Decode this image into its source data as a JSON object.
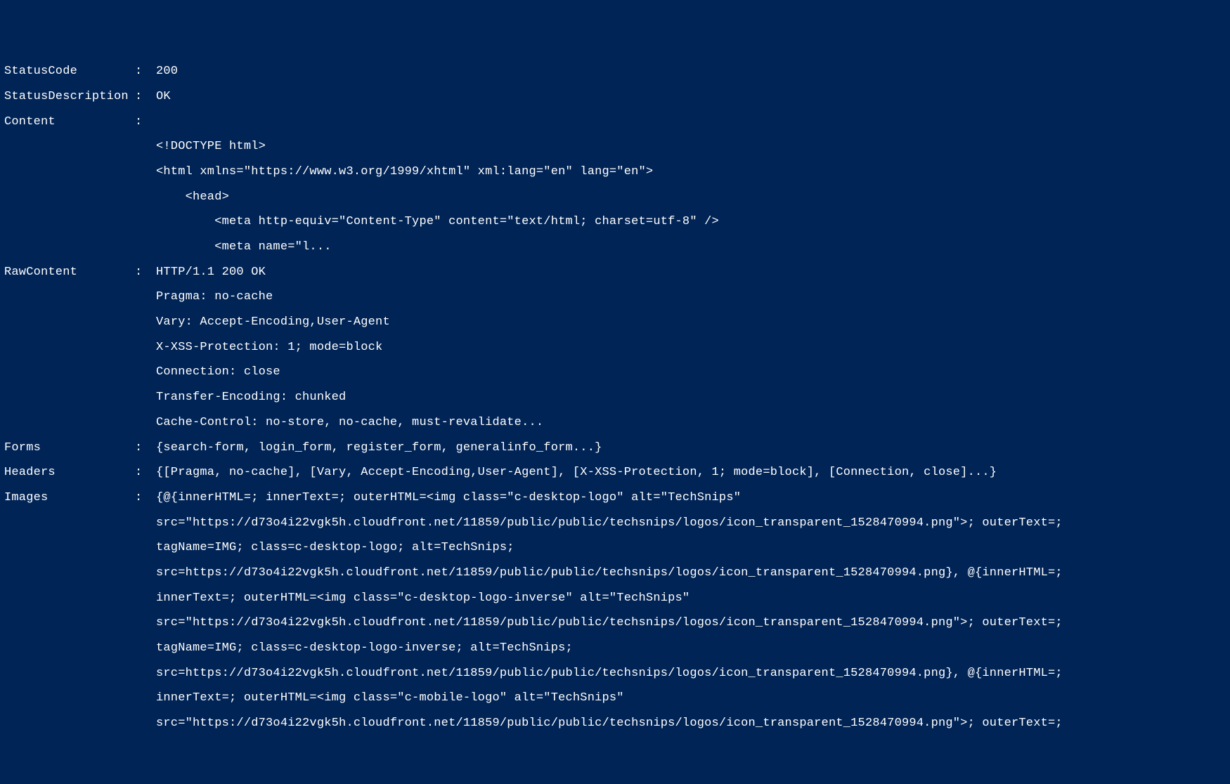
{
  "fields": {
    "statusCode": {
      "key": "StatusCode",
      "value": "200"
    },
    "statusDescription": {
      "key": "StatusDescription",
      "value": "OK"
    },
    "content": {
      "key": "Content",
      "lines": [
        "<!DOCTYPE html>",
        "<html xmlns=\"https://www.w3.org/1999/xhtml\" xml:lang=\"en\" lang=\"en\">",
        "    <head>",
        "        <meta http-equiv=\"Content-Type\" content=\"text/html; charset=utf-8\" />",
        "        <meta name=\"l..."
      ]
    },
    "rawContent": {
      "key": "RawContent",
      "firstValue": "HTTP/1.1 200 OK",
      "lines": [
        "Pragma: no-cache",
        "Vary: Accept-Encoding,User-Agent",
        "X-XSS-Protection: 1; mode=block",
        "Connection: close",
        "Transfer-Encoding: chunked",
        "Cache-Control: no-store, no-cache, must-revalidate..."
      ]
    },
    "forms": {
      "key": "Forms",
      "value": "{search-form, login_form, register_form, generalinfo_form...}"
    },
    "headers": {
      "key": "Headers",
      "value": "{[Pragma, no-cache], [Vary, Accept-Encoding,User-Agent], [X-XSS-Protection, 1; mode=block], [Connection, close]...}"
    },
    "images": {
      "key": "Images",
      "firstValue": "{@{innerHTML=; innerText=; outerHTML=<img class=\"c-desktop-logo\" alt=\"TechSnips\"",
      "lines": [
        "src=\"https://d73o4i22vgk5h.cloudfront.net/11859/public/public/techsnips/logos/icon_transparent_1528470994.png\">; outerText=;",
        "tagName=IMG; class=c-desktop-logo; alt=TechSnips;",
        "src=https://d73o4i22vgk5h.cloudfront.net/11859/public/public/techsnips/logos/icon_transparent_1528470994.png}, @{innerHTML=;",
        "innerText=; outerHTML=<img class=\"c-desktop-logo-inverse\" alt=\"TechSnips\"",
        "src=\"https://d73o4i22vgk5h.cloudfront.net/11859/public/public/techsnips/logos/icon_transparent_1528470994.png\">; outerText=;",
        "tagName=IMG; class=c-desktop-logo-inverse; alt=TechSnips;",
        "src=https://d73o4i22vgk5h.cloudfront.net/11859/public/public/techsnips/logos/icon_transparent_1528470994.png}, @{innerHTML=;",
        "innerText=; outerHTML=<img class=\"c-mobile-logo\" alt=\"TechSnips\"",
        "src=\"https://d73o4i22vgk5h.cloudfront.net/11859/public/public/techsnips/logos/icon_transparent_1528470994.png\">; outerText=;"
      ]
    }
  }
}
